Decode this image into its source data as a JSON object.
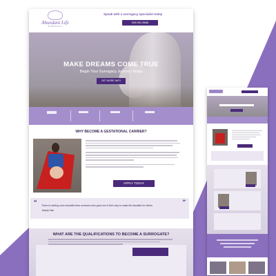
{
  "colors": {
    "brand_purple": "#4a2a7a",
    "lavender": "#a48ecb",
    "background_accent": "#8b6fbf"
  },
  "header": {
    "logo_text": "Abundant Life",
    "logo_sub": "SURROGACY",
    "tagline": "Speak with a surrogacy specialist today",
    "phone": "208.951.5666"
  },
  "hero": {
    "title": "MAKE DREAMS COME TRUE",
    "subtitle": "Begin Your Surrogacy Journey Today",
    "button": "GET MORE INFO"
  },
  "why": {
    "title": "WHY BECOME A GESTATIONAL CARRIER?",
    "apply_button": "APPLY TODAY",
    "quote": "There is nothing more beautiful than someone who goes out of their way to make life beautiful for others",
    "quote_author": "-Mandy Hale"
  },
  "qualifications": {
    "title": "WHAT ARE THE QUALIFICATIONS TO BECOME A SURROGATE?"
  }
}
